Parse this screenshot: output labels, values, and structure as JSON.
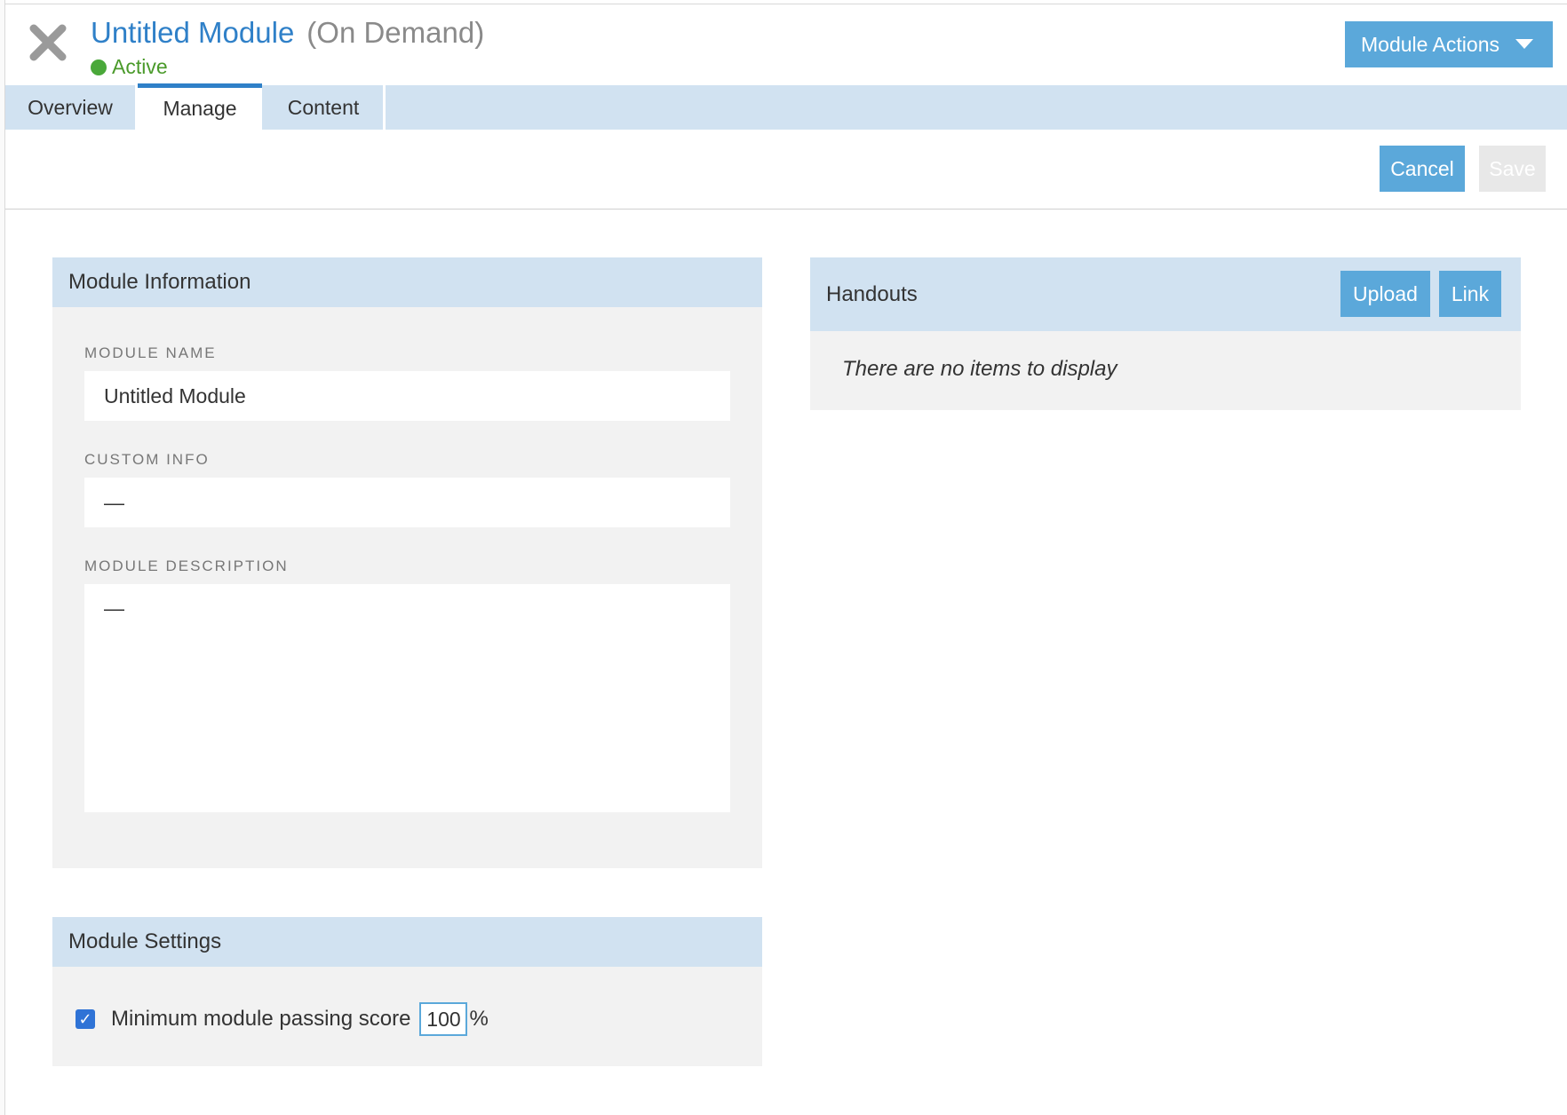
{
  "header": {
    "title": "Untitled Module",
    "subtitle": "(On Demand)",
    "status": "Active",
    "actions_label": "Module Actions"
  },
  "tabs": [
    {
      "label": "Overview",
      "active": false
    },
    {
      "label": "Manage",
      "active": true
    },
    {
      "label": "Content",
      "active": false
    }
  ],
  "toolbar": {
    "cancel_label": "Cancel",
    "save_label": "Save"
  },
  "module_info": {
    "heading": "Module Information",
    "name_label": "MODULE NAME",
    "name_value": "Untitled Module",
    "custom_label": "CUSTOM INFO",
    "custom_value": "—",
    "description_label": "MODULE DESCRIPTION",
    "description_value": "—"
  },
  "module_settings": {
    "heading": "Module Settings",
    "passing_label": "Minimum module passing score",
    "passing_value": "100",
    "passing_unit": "%",
    "passing_checked": true
  },
  "handouts": {
    "heading": "Handouts",
    "upload_label": "Upload",
    "link_label": "Link",
    "empty_message": "There are no items to display"
  },
  "colors": {
    "accent": "#2f80c8",
    "button": "#5ba8da",
    "panel_header": "#d1e2f1",
    "panel_body": "#f2f2f2",
    "status": "#4a9a2a"
  }
}
